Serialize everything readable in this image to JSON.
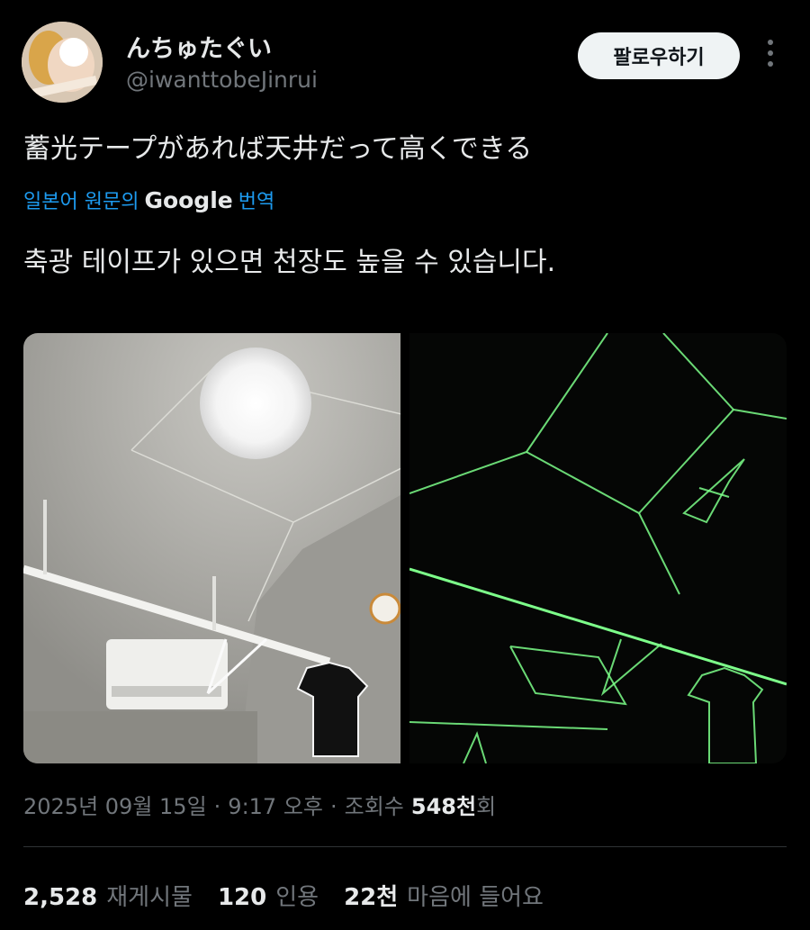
{
  "author": {
    "display_name": "んちゅたぐい",
    "handle": "@iwanttobeJinrui",
    "follow_label": "팔로우하기"
  },
  "tweet": {
    "text": "蓄光テープがあれば天井だって高くできる",
    "translate_prefix": "일본어 원문의",
    "translate_brand": "Google",
    "translate_suffix": "번역",
    "translated_text": "축광 테이프가 있으면 천장도 높을 수 있습니다."
  },
  "meta": {
    "date": "2025년 09월 15일",
    "sep1": "·",
    "time": "9:17 오후",
    "sep2": "·",
    "views_prefix": "조회수",
    "views_num": "548천",
    "views_suffix": "회"
  },
  "stats": {
    "retweets_num": "2,528",
    "retweets_label": "재게시물",
    "quotes_num": "120",
    "quotes_label": "인용",
    "likes_num": "22천",
    "likes_label": "마음에 들어요"
  },
  "colors": {
    "background": "#000000",
    "link_blue": "#1d9bf0",
    "muted": "#71767b",
    "glow_green": "#7dff8a"
  }
}
